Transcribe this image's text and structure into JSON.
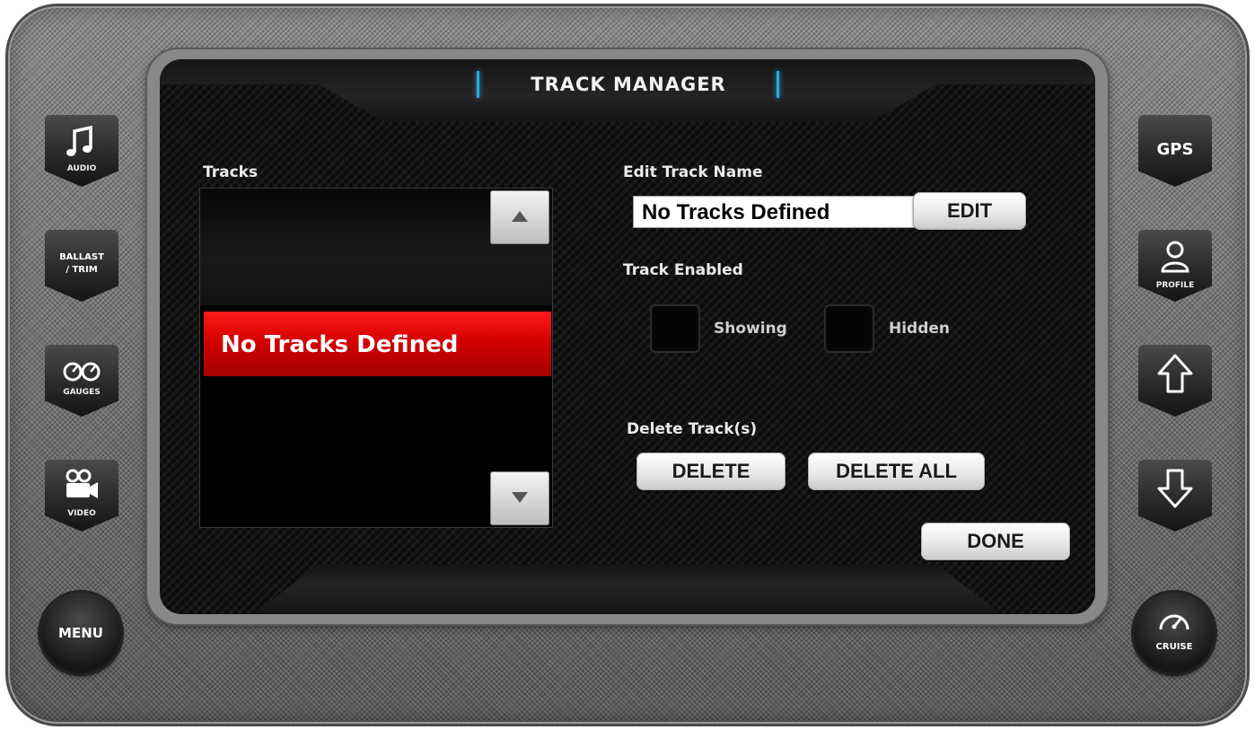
{
  "screen": {
    "title": "TRACK MANAGER"
  },
  "tracks_panel": {
    "label": "Tracks",
    "items": [
      "No Tracks Defined"
    ],
    "selected_index": 0
  },
  "edit_name": {
    "label": "Edit Track Name",
    "value": "No Tracks Defined",
    "edit_button": "EDIT"
  },
  "track_enabled": {
    "label": "Track Enabled",
    "options": [
      {
        "label": "Showing",
        "checked": false
      },
      {
        "label": "Hidden",
        "checked": false
      }
    ]
  },
  "delete_section": {
    "label": "Delete Track(s)",
    "delete_button": "DELETE",
    "delete_all_button": "DELETE ALL"
  },
  "done_button": "DONE",
  "hardware_left": {
    "audio": "AUDIO",
    "ballast_trim_line1": "BALLAST",
    "ballast_trim_line2": "/ TRIM",
    "gauges": "GAUGES",
    "video": "VIDEO",
    "menu": "MENU"
  },
  "hardware_right": {
    "gps": "GPS",
    "profile": "PROFILE",
    "cruise": "CRUISE"
  },
  "colors": {
    "selected_row": "#e00000",
    "title_accent": "#2aa9e0"
  },
  "icons": [
    "music-note-icon",
    "gauges-icon",
    "video-camera-icon",
    "profile-person-icon",
    "arrow-up-icon",
    "arrow-down-icon",
    "speedometer-icon",
    "triangle-up-icon",
    "triangle-down-icon"
  ]
}
